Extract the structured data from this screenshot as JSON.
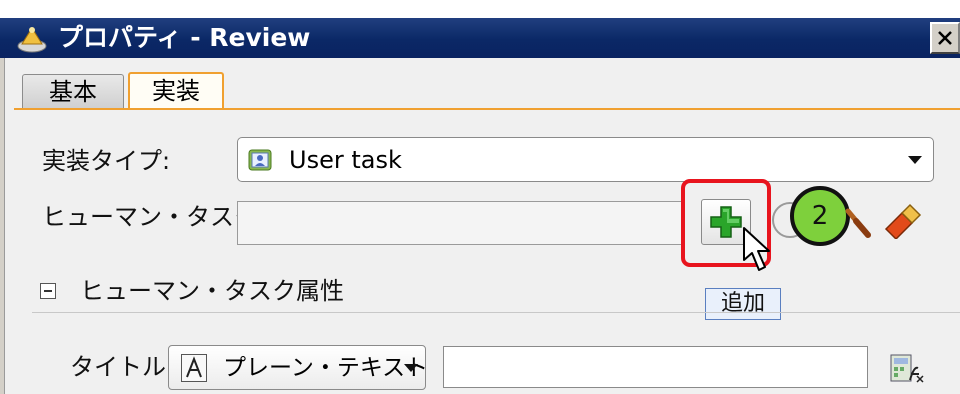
{
  "window": {
    "title": "プロパティ - Review",
    "close_icon": "close-icon",
    "app_icon": "dialog-app-icon"
  },
  "tabs": [
    {
      "label": "基本",
      "active": false
    },
    {
      "label": "実装",
      "active": true
    }
  ],
  "form": {
    "impl_type_label": "実装タイプ:",
    "impl_type_value": "User task",
    "impl_type_icon": "user-task-icon",
    "human_task_label": "ヒューマン・タスク:",
    "human_task_value": "",
    "add_tooltip": "追加",
    "step_badge": "2",
    "section_label": "ヒューマン・タスク属性",
    "title_label": "タイトル:",
    "title_type_value": "プレーン・テキスト",
    "title_value": ""
  },
  "colors": {
    "titlebar": "#0b2866",
    "active_tab_border": "#f0a030",
    "highlight_box": "#e8141e",
    "badge_fill": "#7ed03c"
  },
  "icons": {
    "add": "add-plus-icon",
    "browse": "circle-icon",
    "search": "magnifier-icon",
    "clear": "eraser-icon",
    "expression": "expression-editor-icon",
    "cursor": "mouse-pointer-icon"
  }
}
